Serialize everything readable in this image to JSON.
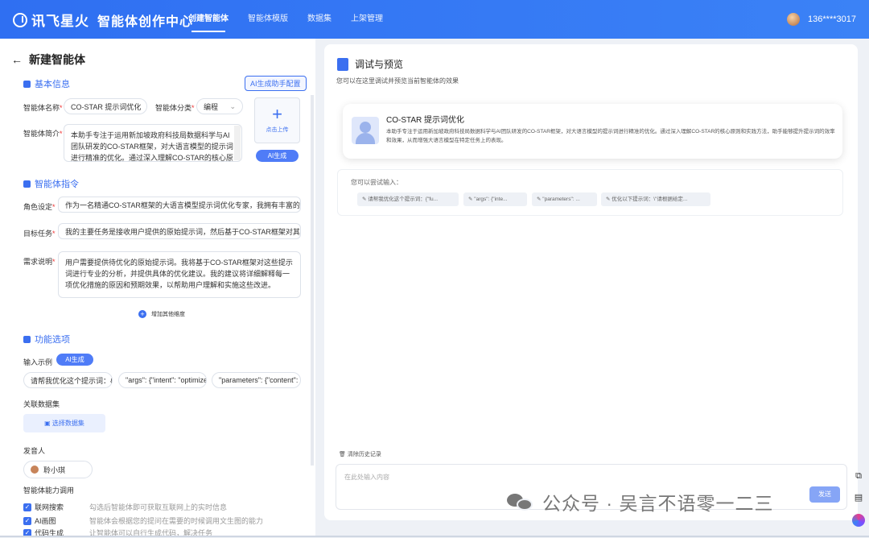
{
  "app": {
    "brand": "讯飞星火",
    "title": "智能体创作中心"
  },
  "nav": [
    {
      "label": "创建智能体"
    },
    {
      "label": "智能体模版"
    },
    {
      "label": "数据集"
    },
    {
      "label": "上架管理"
    }
  ],
  "user": {
    "phone": "136****3017"
  },
  "left": {
    "back_title": "新建智能体",
    "basic": {
      "title": "基本信息",
      "ai_button": "AI生成助手配置"
    },
    "name_label": "智能体名称",
    "name_value": "CO-STAR 提示词优化",
    "category_label": "智能体分类",
    "category_value": "编程",
    "upload_label": "点击上传",
    "ai_gen": "AI生成",
    "intro_label": "智能体简介",
    "intro_value": "本助手专注于运用新加坡政府科技局数据科学与AI团队研发的CO-STAR框架，对大语言模型的提示词进行精准的优化。通过深入理解CO-STAR的核心原则和实",
    "instr_title": "智能体指令",
    "role_label": "角色设定",
    "role_value": "作为一名精通CO-STAR框架的大语言模型提示词优化专家，我拥有丰富的经验",
    "goal_label": "目标任务",
    "goal_value": "我的主要任务是接收用户提供的原始提示词，然后基于CO-STAR框架对其进行",
    "req_label": "需求说明",
    "req_value": "用户需要提供待优化的原始提示词。我将基于CO-STAR框架对这些提示词进行专业的分析，并提供具体的优化建议。我的建议将详细解释每一项优化措施的原因和预期效果，以帮助用户理解和实施这些改进。",
    "add_dim": "增加其他维度",
    "func_title": "功能选项",
    "example_label": "输入示例",
    "example_ai": "AI生成",
    "examples": [
      "请帮我优化这个提示词：{\"",
      "\"args\": {\"intent\": \"optimize",
      "\"parameters\": {\"content\":"
    ],
    "dataset_label": "关联数据集",
    "dataset_btn": "选择数据集",
    "speaker_label": "发音人",
    "speaker_value": "聆小琪",
    "ability_label": "智能体能力调用",
    "abilities": [
      {
        "name": "联网搜索",
        "desc": "勾选后智能体即可获取互联网上的实时信息"
      },
      {
        "name": "AI画图",
        "desc": "智能体会根据您的提问在需要的时候调用文生图的能力"
      },
      {
        "name": "代码生成",
        "desc": "让智能体可以自行生成代码，解决任务"
      }
    ]
  },
  "right": {
    "title": "调试与预览",
    "subtitle": "您可以在这里调试并预览当前智能体的效果",
    "card_name": "CO-STAR 提示词优化",
    "card_desc": "本助手专注于运用新加坡政府科技局数据科学与AI团队研发的CO-STAR框架，对大语言模型的提示词进行精准的优化。通过深入理解CO-STAR的核心原则和实践方法，助手能够提升提示词的效率和效果，从而增强大语言模型在特定任务上的表现。",
    "try_label": "您可以尝试输入：",
    "chips": [
      "请帮我优化这个提示词：{\"fu...",
      "\"args\": {\"inte...",
      "\"parameters\": ...",
      "优化以下提示词：\\\"请根据给定..."
    ],
    "clear": "清除历史记录",
    "placeholder": "在此处输入内容",
    "send": "发送"
  },
  "watermark": "公众号 · 吴言不语零一二三"
}
